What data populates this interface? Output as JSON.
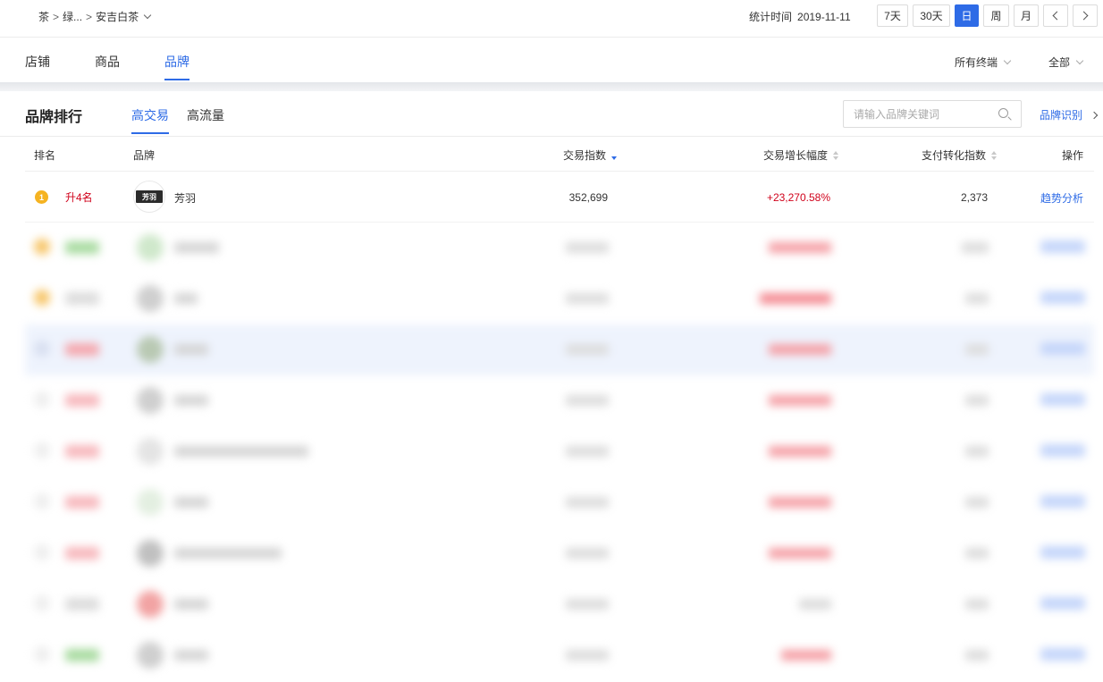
{
  "breadcrumb": {
    "items": [
      "茶",
      "绿...",
      "安吉白茶"
    ],
    "separator": ">"
  },
  "stat_time": {
    "label": "统计时间",
    "value": "2019-11-11"
  },
  "periods": [
    {
      "label": "7天",
      "active": false
    },
    {
      "label": "30天",
      "active": false
    },
    {
      "label": "日",
      "active": true
    },
    {
      "label": "周",
      "active": false
    },
    {
      "label": "月",
      "active": false
    }
  ],
  "nav": {
    "tabs": [
      {
        "label": "店铺",
        "active": false
      },
      {
        "label": "商品",
        "active": false
      },
      {
        "label": "品牌",
        "active": true
      }
    ],
    "terminal_select": "所有终端",
    "scope_select": "全部"
  },
  "section": {
    "title": "品牌排行",
    "subtabs": [
      {
        "label": "高交易",
        "active": true
      },
      {
        "label": "高流量",
        "active": false
      }
    ],
    "search_placeholder": "请输入品牌关键词",
    "brand_link": "品牌识别"
  },
  "table": {
    "columns": {
      "rank": "排名",
      "brand": "品牌",
      "trade_index": "交易指数",
      "growth": "交易增长幅度",
      "conversion": "支付转化指数",
      "action": "操作"
    },
    "sort": {
      "column": "trade_index",
      "direction": "desc"
    },
    "rows": [
      {
        "rank": "1",
        "rank_change": "升4名",
        "logo_text": "芳羽",
        "brand": "芳羽",
        "trade_index": "352,699",
        "growth": "+23,270.58%",
        "conversion": "2,373",
        "action": "趋势分析"
      }
    ]
  },
  "colors": {
    "accent": "#2e6be6",
    "negative_red": "#d0021b",
    "medal_gold": "#f5b321"
  }
}
